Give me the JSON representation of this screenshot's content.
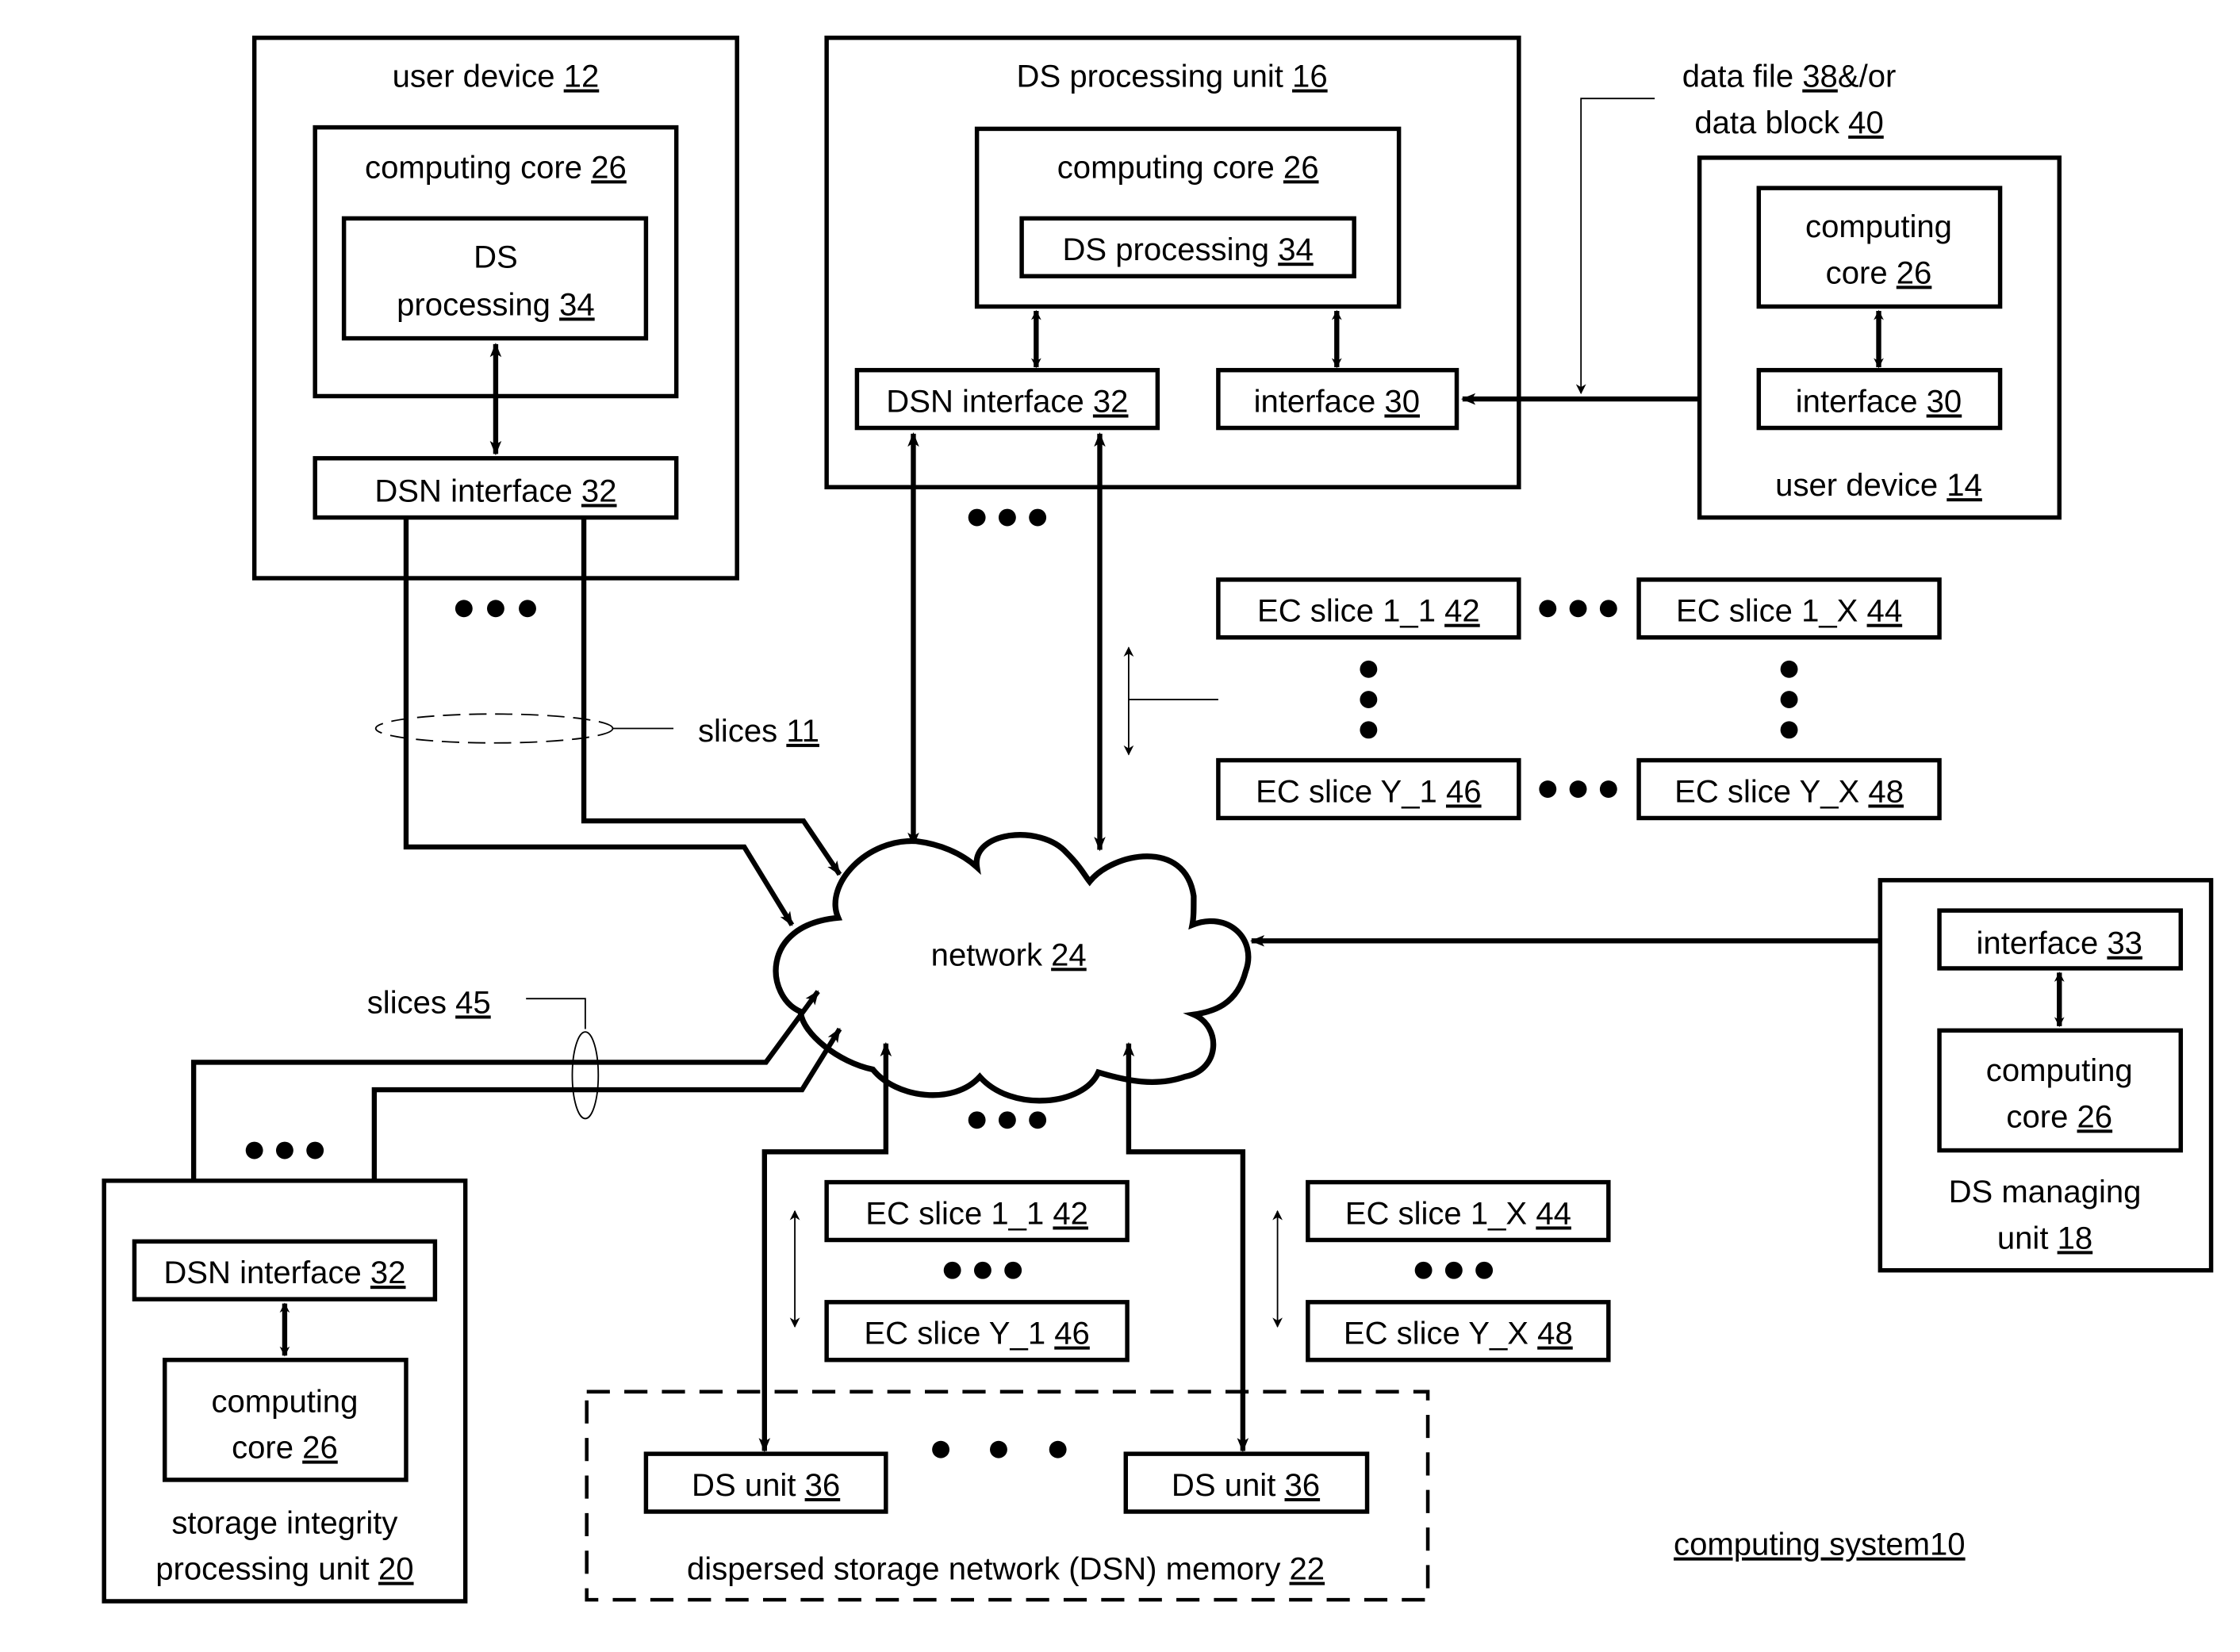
{
  "figure": {
    "caption": "computing system10",
    "colors": {
      "line": "#000000",
      "background": "#ffffff"
    }
  },
  "user_device_12": {
    "title": "user device ",
    "ref": "12",
    "core": {
      "label": "computing core ",
      "ref": "26"
    },
    "ds_processing": {
      "line1": "DS",
      "line2": "processing ",
      "ref": "34"
    },
    "dsn_interface": {
      "label": "DSN interface ",
      "ref": "32"
    }
  },
  "ds_processing_unit_16": {
    "title": "DS processing unit ",
    "ref": "16",
    "core": {
      "label": "computing core ",
      "ref": "26"
    },
    "ds_processing": {
      "label": "DS processing ",
      "ref": "34"
    },
    "dsn_interface": {
      "label": "DSN interface ",
      "ref": "32"
    },
    "interface": {
      "label": "interface ",
      "ref": "30"
    }
  },
  "user_device_14": {
    "title": "user device ",
    "ref": "14",
    "core": {
      "line1": "computing",
      "line2": "core ",
      "ref": "26"
    },
    "interface": {
      "label": "interface ",
      "ref": "30"
    }
  },
  "data_label": {
    "line1_prefix": "data file ",
    "line1_ref": "38",
    "line1_suffix": "&/or",
    "line2_prefix": "data block ",
    "line2_ref": "40"
  },
  "slices_11": {
    "label": "slices ",
    "ref": "11"
  },
  "slices_45": {
    "label": "slices ",
    "ref": "45"
  },
  "network": {
    "label": "network ",
    "ref": "24"
  },
  "ec_grid": [
    {
      "label": "EC slice 1_1 ",
      "ref": "42"
    },
    {
      "label": "EC slice 1_X ",
      "ref": "44"
    },
    {
      "label": "EC slice Y_1 ",
      "ref": "46"
    },
    {
      "label": "EC slice Y_X ",
      "ref": "48"
    }
  ],
  "ds_managing_unit_18": {
    "title_line1": "DS managing",
    "title_line2": "unit ",
    "ref": "18",
    "interface": {
      "label": "interface ",
      "ref": "33"
    },
    "core": {
      "line1": "computing",
      "line2": "core ",
      "ref": "26"
    }
  },
  "storage_integrity_unit_20": {
    "title_line1": "storage integrity",
    "title_line2": "processing unit ",
    "ref": "20",
    "dsn_interface": {
      "label": "DSN interface ",
      "ref": "32"
    },
    "core": {
      "line1": "computing",
      "line2": "core ",
      "ref": "26"
    }
  },
  "ds_unit_slices": {
    "left": [
      {
        "label": "EC slice 1_1 ",
        "ref": "42"
      },
      {
        "label": "EC slice Y_1 ",
        "ref": "46"
      }
    ],
    "right": [
      {
        "label": "EC slice 1_X ",
        "ref": "44"
      },
      {
        "label": "EC slice Y_X ",
        "ref": "48"
      }
    ]
  },
  "dsn_memory_22": {
    "title": "dispersed storage network (DSN) memory ",
    "ref": "22",
    "units": [
      {
        "label": "DS unit ",
        "ref": "36"
      },
      {
        "label": "DS unit ",
        "ref": "36"
      }
    ]
  }
}
